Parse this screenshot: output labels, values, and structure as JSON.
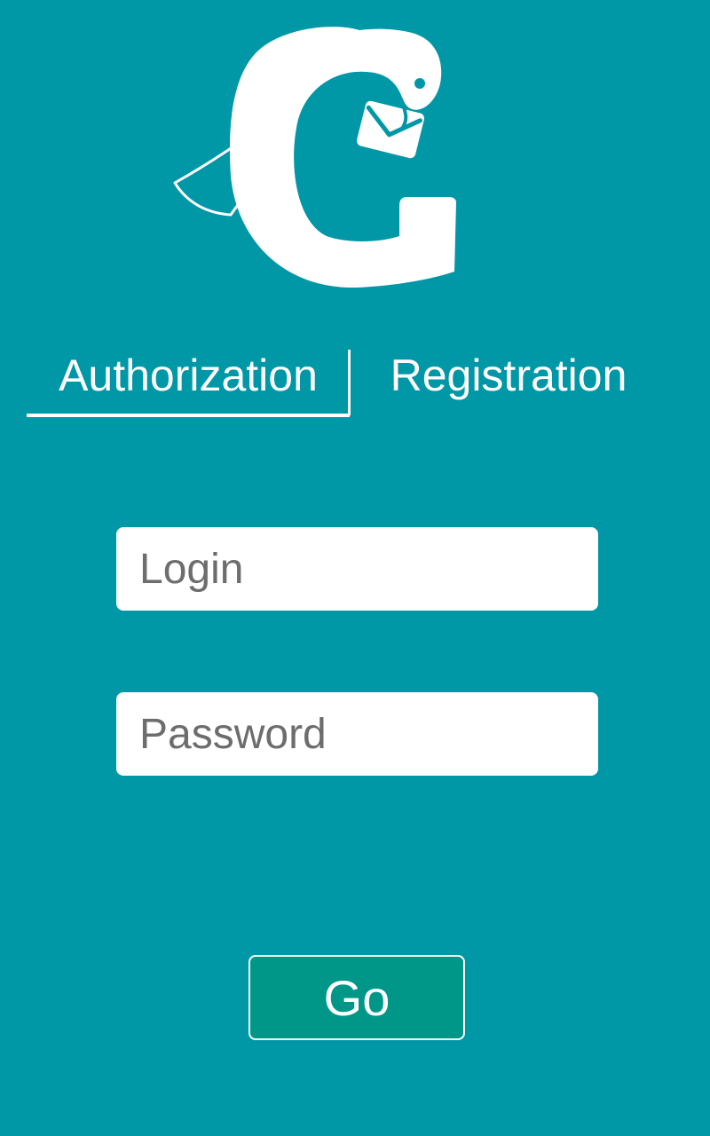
{
  "app": {
    "logo_icon": "bird-g-envelope-logo"
  },
  "tabs": {
    "authorization_label": "Authorization",
    "registration_label": "Registration",
    "active": "authorization"
  },
  "form": {
    "login_placeholder": "Login",
    "login_value": "",
    "password_placeholder": "Password",
    "password_value": "",
    "submit_label": "Go"
  },
  "colors": {
    "background": "#0097a7",
    "button": "#009688",
    "foreground": "#ffffff"
  }
}
